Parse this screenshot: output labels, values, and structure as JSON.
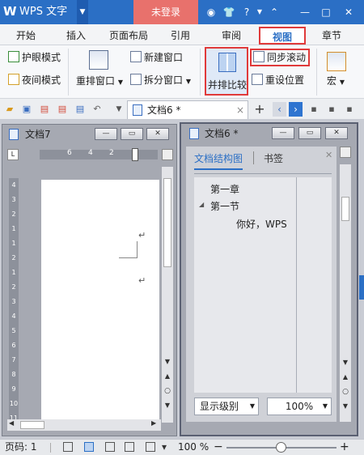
{
  "title": {
    "logo": "W",
    "app_name": "WPS 文字",
    "login": "未登录"
  },
  "tabs": [
    "开始",
    "插入",
    "页面布局",
    "引用",
    "审阅",
    "视图",
    "章节"
  ],
  "ribbon": {
    "eye_mode": "护眼模式",
    "night_mode": "夜间模式",
    "rearrange": "重排窗口",
    "new_window": "新建窗口",
    "split_window": "拆分窗口",
    "side_by_side": "并排比较",
    "sync_scroll": "同步滚动",
    "reset_position": "重设位置",
    "macro": "宏"
  },
  "quick_access": {
    "doc_tab_label": "文档6 *",
    "close": "×",
    "add": "+"
  },
  "left_window": {
    "title": "文档7",
    "ruler_numbers": [
      "6",
      "4",
      "2"
    ],
    "vertical_ruler": [
      "4",
      "3",
      "2",
      "1",
      "1",
      "2",
      "1",
      "2",
      "3",
      "4",
      "5",
      "6",
      "7",
      "8",
      "9",
      "10",
      "11"
    ],
    "para_mark": "↵"
  },
  "right_window": {
    "title": "文档6 *",
    "nav_tab_active": "文档结构图",
    "nav_tab_bookmark": "书签",
    "outline": [
      "第一章",
      "第一节",
      "你好，WPS"
    ],
    "display_level": "显示级别",
    "zoom": "100%"
  },
  "status": {
    "page_label": "页码: 1",
    "zoom": "100 %"
  },
  "colors": {
    "title_bar": "#2b6fc5",
    "login": "#e8716c",
    "highlight": "#e03a3a"
  }
}
